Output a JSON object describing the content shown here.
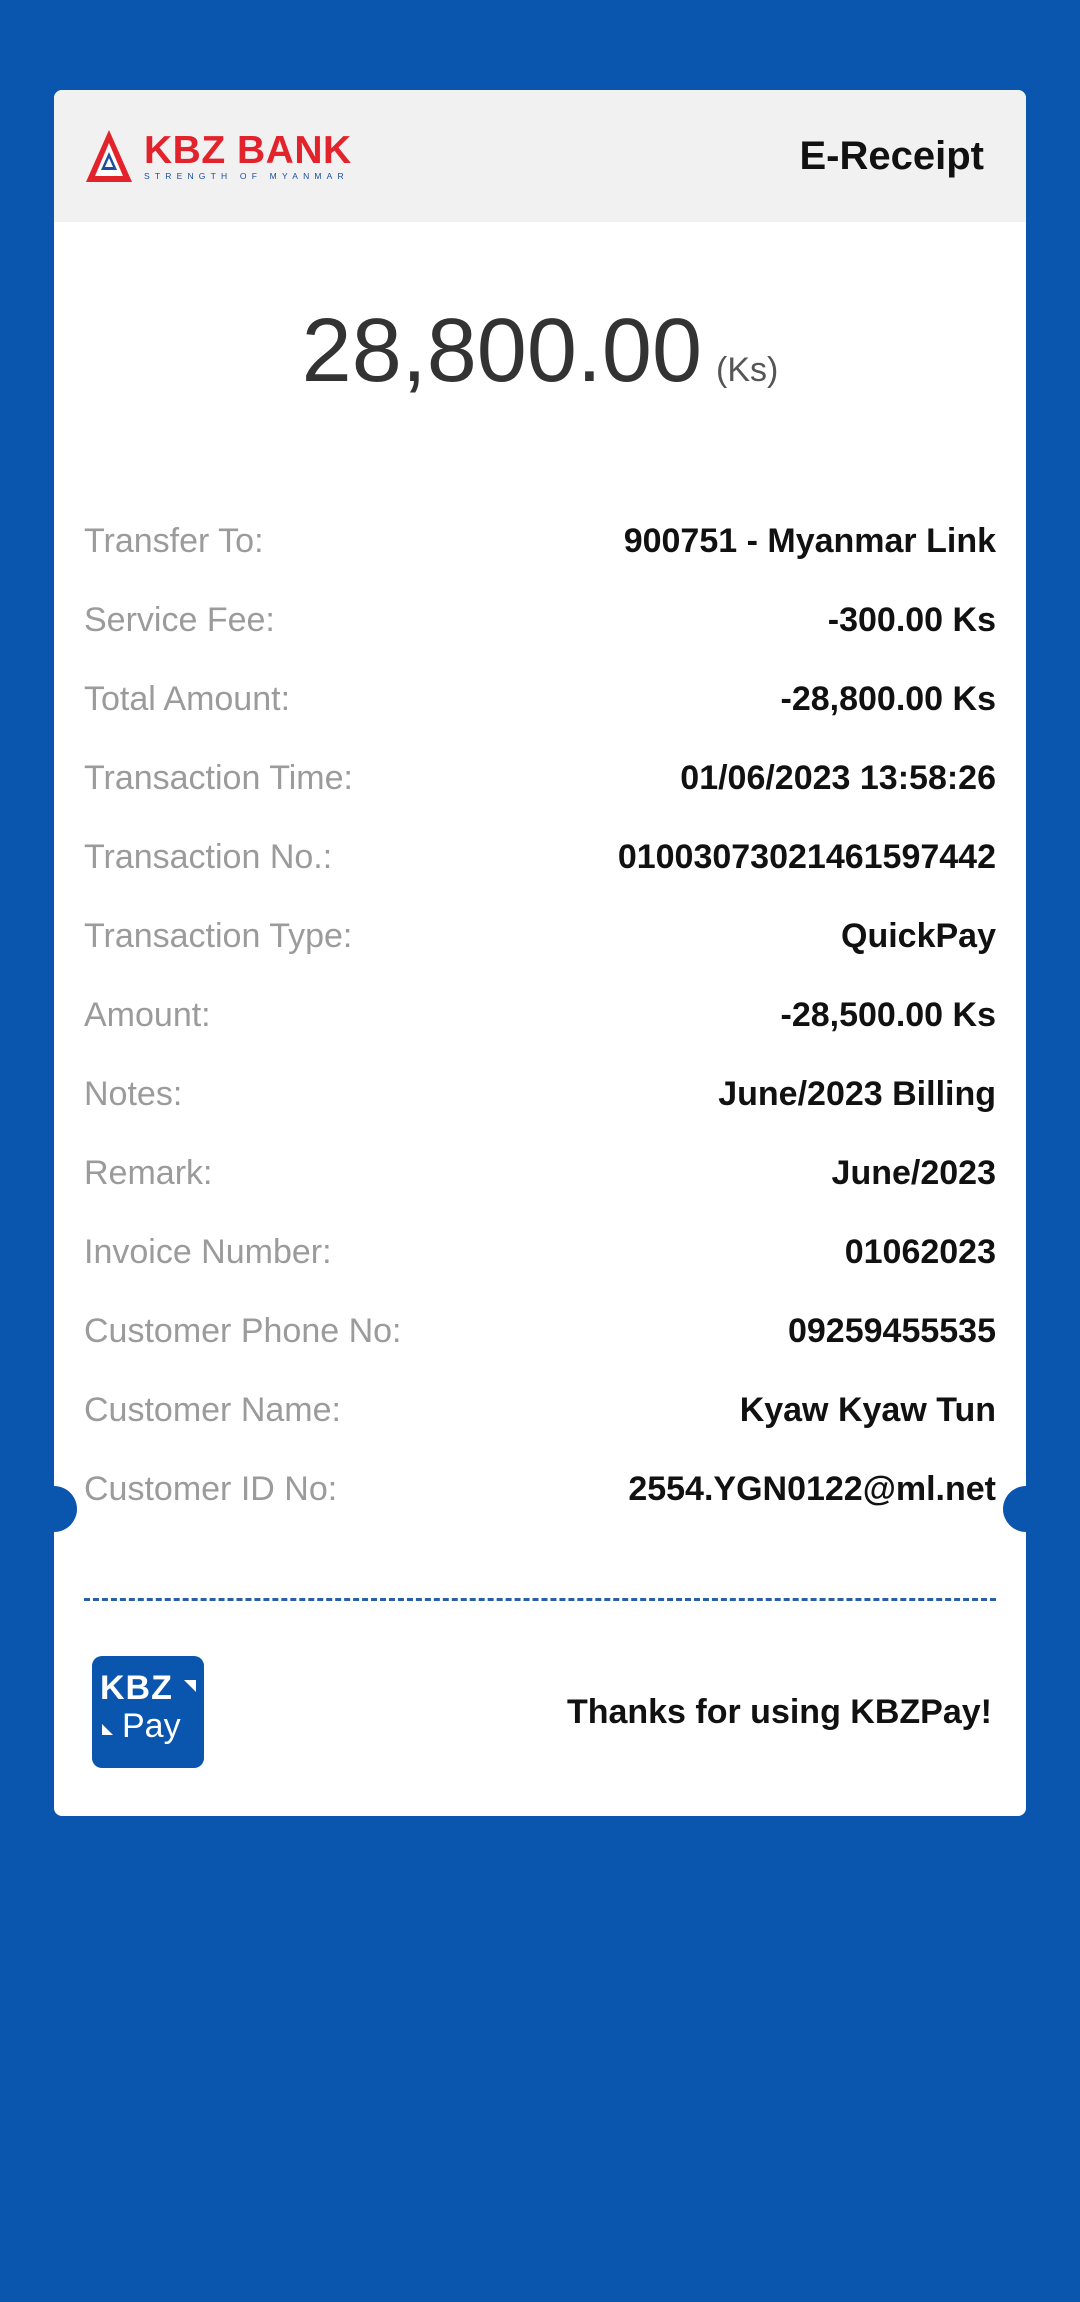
{
  "header": {
    "brand_name": "KBZ BANK",
    "brand_tagline": "STRENGTH OF MYANMAR",
    "title": "E-Receipt"
  },
  "amount": {
    "value": "28,800.00",
    "unit": "(Ks)"
  },
  "details": [
    {
      "label": "Transfer To:",
      "value": "900751 - Myanmar Link"
    },
    {
      "label": "Service Fee:",
      "value": "-300.00 Ks"
    },
    {
      "label": "Total Amount:",
      "value": "-28,800.00 Ks"
    },
    {
      "label": "Transaction Time:",
      "value": "01/06/2023 13:58:26"
    },
    {
      "label": "Transaction No.:",
      "value": "01003073021461597442"
    },
    {
      "label": "Transaction Type:",
      "value": "QuickPay"
    },
    {
      "label": "Amount:",
      "value": "-28,500.00 Ks"
    },
    {
      "label": "Notes:",
      "value": "June/2023 Billing"
    },
    {
      "label": "Remark:",
      "value": "June/2023"
    },
    {
      "label": "Invoice Number:",
      "value": "01062023"
    },
    {
      "label": "Customer Phone No:",
      "value": "09259455535"
    },
    {
      "label": "Customer Name:",
      "value": "Kyaw Kyaw Tun"
    },
    {
      "label": "Customer ID No:",
      "value": "2554.YGN0122@ml.net"
    }
  ],
  "footer": {
    "app_logo_top": "KBZ",
    "app_logo_bottom": "Pay",
    "thanks": "Thanks for using KBZPay!"
  },
  "colors": {
    "background": "#0a55ad",
    "brand_red": "#e3232b",
    "brand_blue": "#1b4fa0"
  },
  "icons": {
    "bank_logo": "kbz-triangle-logo-icon",
    "app_logo": "kbzpay-logo-icon"
  }
}
